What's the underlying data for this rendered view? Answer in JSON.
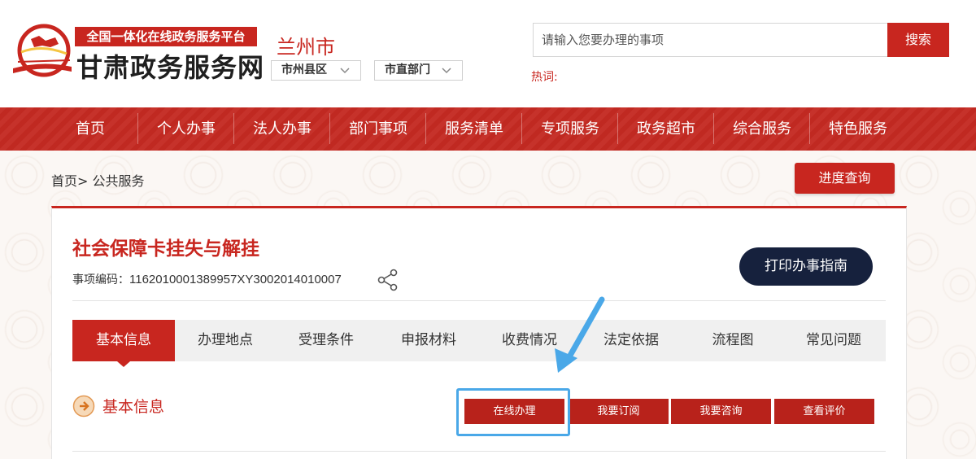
{
  "header": {
    "platform_tag": "全国一体化在线政务服务平台",
    "site_title": "甘肃政务服务网",
    "city": "兰州市",
    "region_select": "市州县区",
    "department_select": "市直部门",
    "search_placeholder": "请输入您要办理的事项",
    "search_button": "搜索",
    "hot_words_label": "热词:"
  },
  "nav": {
    "items": [
      "首页",
      "个人办事",
      "法人办事",
      "部门事项",
      "服务清单",
      "专项服务",
      "政务超市",
      "综合服务",
      "特色服务"
    ]
  },
  "breadcrumb": {
    "home": "首页>",
    "current": "公共服务"
  },
  "progress_button": "进度查询",
  "item": {
    "title": "社会保障卡挂失与解挂",
    "code_label": "事项编码：",
    "code_value": "1162010001389957XY3002014010007",
    "print_button": "打印办事指南"
  },
  "tabs": [
    {
      "label": "基本信息",
      "active": true
    },
    {
      "label": "办理地点",
      "active": false
    },
    {
      "label": "受理条件",
      "active": false
    },
    {
      "label": "申报材料",
      "active": false
    },
    {
      "label": "收费情况",
      "active": false
    },
    {
      "label": "法定依据",
      "active": false
    },
    {
      "label": "流程图",
      "active": false
    },
    {
      "label": "常见问题",
      "active": false
    }
  ],
  "section": {
    "title": "基本信息"
  },
  "actions": {
    "online": "在线办理",
    "subscribe": "我要订阅",
    "consult": "我要咨询",
    "reviews": "查看评价"
  },
  "colors": {
    "brand_red": "#c8261f",
    "print_navy": "#16213d",
    "highlight_blue": "#4aa8e8"
  }
}
